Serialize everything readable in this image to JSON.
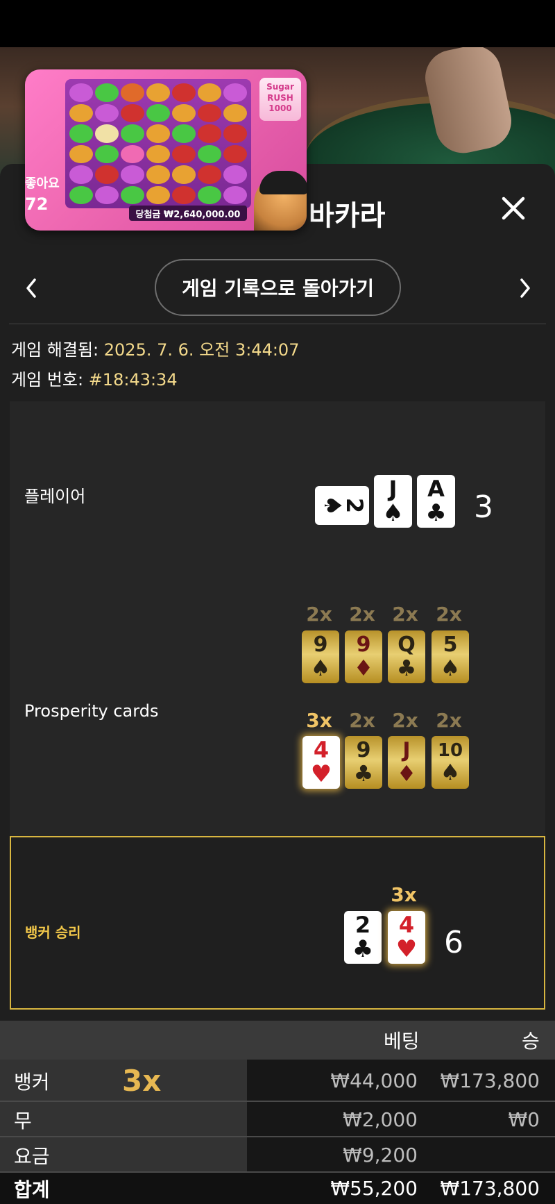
{
  "overlay": {
    "likes_label": "좋아요",
    "likes_count": "72",
    "slot_win_text": "당첨금 ₩2,640,000.00",
    "slot_logo": "Sugar RUSH 1000"
  },
  "header": {
    "title": "바카라",
    "back_button": "게임 기록으로 돌아가기"
  },
  "info": {
    "resolved_label": "게임 해결됨:",
    "resolved_value": "2025. 7. 6. 오전 3:44:07",
    "game_no_label": "게임 번호:",
    "game_no_value": "#18:43:34"
  },
  "player": {
    "label": "플레이어",
    "score": "3",
    "cards": [
      {
        "rank": "2",
        "suit": "♠",
        "color": "black",
        "orientation": "sideways"
      },
      {
        "rank": "J",
        "suit": "♠",
        "color": "black"
      },
      {
        "rank": "A",
        "suit": "♣",
        "color": "black"
      }
    ]
  },
  "prosperity": {
    "label": "Prosperity cards",
    "row1": [
      {
        "mult": "2x",
        "rank": "9",
        "suit": "♠",
        "color": "black"
      },
      {
        "mult": "2x",
        "rank": "9",
        "suit": "♦",
        "color": "red"
      },
      {
        "mult": "2x",
        "rank": "Q",
        "suit": "♣",
        "color": "black"
      },
      {
        "mult": "2x",
        "rank": "5",
        "suit": "♠",
        "color": "black"
      }
    ],
    "row2": [
      {
        "mult": "3x",
        "rank": "4",
        "suit": "♥",
        "color": "red",
        "highlight": true
      },
      {
        "mult": "2x",
        "rank": "9",
        "suit": "♣",
        "color": "black"
      },
      {
        "mult": "2x",
        "rank": "J",
        "suit": "♦",
        "color": "red"
      },
      {
        "mult": "2x",
        "rank": "10",
        "suit": "♠",
        "color": "black"
      }
    ]
  },
  "banker": {
    "label": "뱅커 승리",
    "score": "6",
    "mult": "3x",
    "cards": [
      {
        "rank": "2",
        "suit": "♣",
        "color": "black"
      },
      {
        "rank": "4",
        "suit": "♥",
        "color": "red",
        "highlight": true
      }
    ]
  },
  "table": {
    "headers": {
      "bet": "베팅",
      "win": "승"
    },
    "rows": [
      {
        "name": "뱅커",
        "mult": "3x",
        "bet": "₩44,000",
        "win": "₩173,800"
      },
      {
        "name": "무",
        "mult": "",
        "bet": "₩2,000",
        "win": "₩0"
      },
      {
        "name": "요금",
        "mult": "",
        "bet": "₩9,200",
        "win": ""
      }
    ],
    "total": {
      "name": "합계",
      "bet": "₩55,200",
      "win": "₩173,800"
    }
  },
  "colors": {
    "accent_gold": "#f3c84a",
    "value_text": "#f3d98b",
    "panel_bg": "#1f1f1f"
  }
}
